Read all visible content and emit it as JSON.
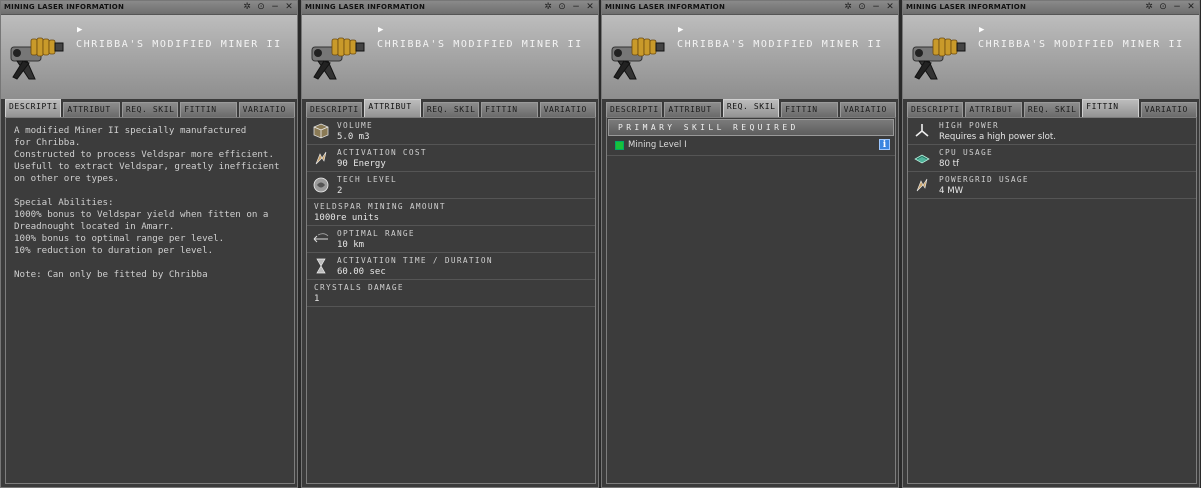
{
  "windows": [
    {
      "title": "MINING LASER INFORMATION",
      "item_name": "CHRIBBA'S MODIFIED MINER II",
      "tabs": [
        "DESCRIPTI",
        "ATTRIBUT",
        "REQ. SKIL",
        "FITTIN",
        "VARIATIO"
      ],
      "active_tab": 0,
      "description": "A modified Miner II specially manufactured\nfor Chribba.\nConstructed to process Veldspar more efficient.\nUsefull to extract Veldspar, greatly inefficient\non other ore types.\n\nSpecial Abilities:\n1000% bonus to Veldspar yield when fitten on a\nDreadnought located in Amarr.\n100% bonus to optimal range per level.\n10% reduction to duration per level.\n\nNote: Can only be fitted by Chribba"
    },
    {
      "title": "MINING LASER INFORMATION",
      "item_name": "CHRIBBA'S MODIFIED MINER II",
      "tabs": [
        "DESCRIPTI",
        "ATTRIBUT",
        "REQ. SKIL",
        "FITTIN",
        "VARIATIO"
      ],
      "active_tab": 1,
      "attributes": [
        {
          "label": "VOLUME",
          "value": "5.0 m3",
          "icon": "cube-icon"
        },
        {
          "label": "ACTIVATION COST",
          "value": "90 Energy",
          "icon": "energy-icon"
        },
        {
          "label": "TECH LEVEL",
          "value": "2",
          "icon": "tech-level-icon"
        },
        {
          "label": "VELDSPAR MINING AMOUNT",
          "value": "1000re units",
          "icon": ""
        },
        {
          "label": "OPTIMAL RANGE",
          "value": "10 km",
          "icon": "range-icon"
        },
        {
          "label": "ACTIVATION TIME / DURATION",
          "value": "60.00 sec",
          "icon": "hourglass-icon"
        },
        {
          "label": "CRYSTALS DAMAGE",
          "value": "1",
          "icon": ""
        }
      ]
    },
    {
      "title": "MINING LASER INFORMATION",
      "item_name": "CHRIBBA'S MODIFIED MINER II",
      "tabs": [
        "DESCRIPTI",
        "ATTRIBUT",
        "REQ. SKIL",
        "FITTIN",
        "VARIATIO"
      ],
      "active_tab": 2,
      "skills_header": "PRIMARY SKILL REQUIRED",
      "skills": [
        {
          "name": "Mining Level I",
          "icon": "info-icon",
          "icon_glyph": "i"
        }
      ]
    },
    {
      "title": "MINING LASER INFORMATION",
      "item_name": "CHRIBBA'S MODIFIED MINER II",
      "tabs": [
        "DESCRIPTI",
        "ATTRIBUT",
        "REQ. SKIL",
        "FITTIN",
        "VARIATIO"
      ],
      "active_tab": 3,
      "fitting": [
        {
          "label": "HIGH POWER",
          "value": "Requires a high power slot.",
          "icon": "high-power-icon"
        },
        {
          "label": "CPU USAGE",
          "value": "80 tf",
          "icon": "cpu-icon"
        },
        {
          "label": "POWERGRID USAGE",
          "value": "4 MW",
          "icon": "powergrid-icon"
        }
      ]
    }
  ],
  "window_buttons": [
    "✲",
    "⊙",
    "−",
    "✕"
  ]
}
